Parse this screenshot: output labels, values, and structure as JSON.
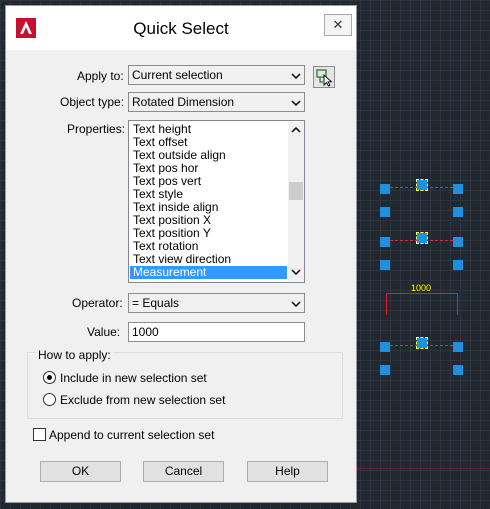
{
  "dialog": {
    "title": "Quick Select",
    "close_glyph": "✕",
    "apply_to": {
      "label": "Apply to:",
      "value": "Current selection"
    },
    "object_type": {
      "label": "Object type:",
      "value": "Rotated Dimension"
    },
    "properties": {
      "label": "Properties:",
      "items": [
        "Text height",
        "Text offset",
        "Text outside align",
        "Text pos hor",
        "Text pos vert",
        "Text style",
        "Text inside align",
        "Text position X",
        "Text position Y",
        "Text rotation",
        "Text view direction",
        "Measurement"
      ],
      "selected": "Measurement"
    },
    "operator": {
      "label": "Operator:",
      "value": "= Equals"
    },
    "value": {
      "label": "Value:",
      "value": "1000"
    },
    "how_to_apply": {
      "title": "How to apply:",
      "include_label": "Include in new selection set",
      "exclude_label": "Exclude from new selection set",
      "selected": "include"
    },
    "append_label": "Append to current selection set",
    "append_checked": false,
    "buttons": {
      "ok": "OK",
      "cancel": "Cancel",
      "help": "Help"
    }
  },
  "canvas": {
    "dimension_text": "1000",
    "colors": {
      "background": "#212830",
      "grip": "#1f8fe0",
      "dimension": "#d03030",
      "text": "#ffff00"
    }
  },
  "icons": {
    "app": "autocad-logo-icon",
    "quick_select": "select-objects-icon",
    "dropdown": "chevron-down-icon"
  }
}
